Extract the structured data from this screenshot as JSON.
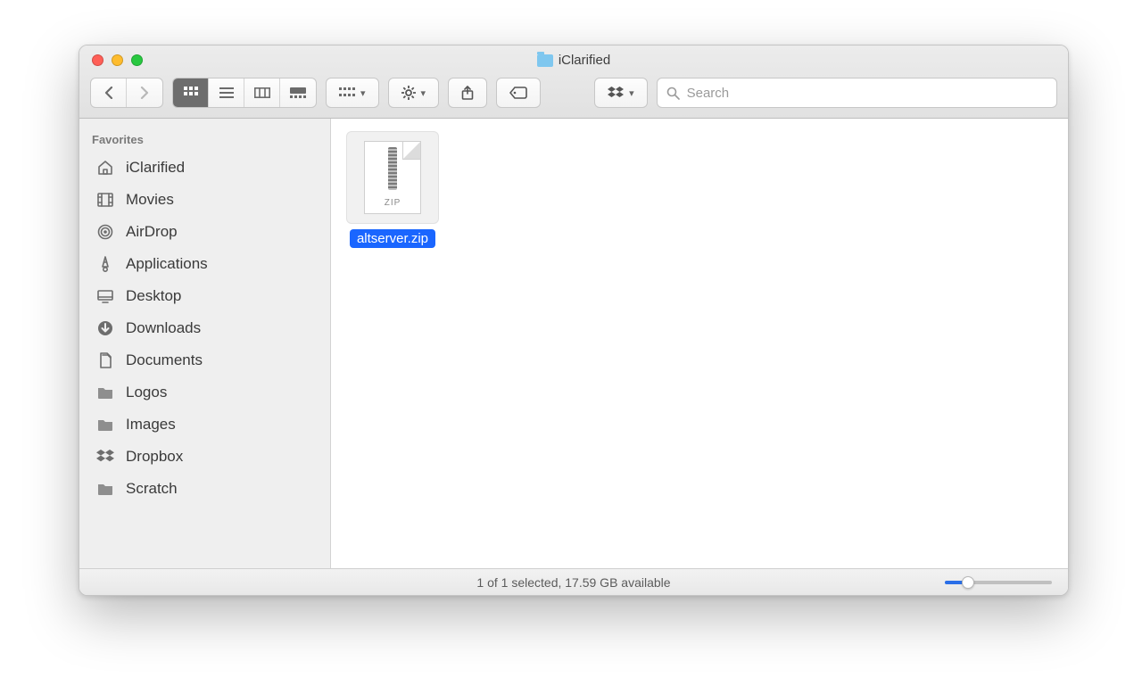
{
  "window": {
    "title": "iClarified"
  },
  "search": {
    "placeholder": "Search",
    "value": ""
  },
  "sidebar": {
    "section_label": "Favorites",
    "items": [
      {
        "icon": "home",
        "label": "iClarified"
      },
      {
        "icon": "movies",
        "label": "Movies"
      },
      {
        "icon": "airdrop",
        "label": "AirDrop"
      },
      {
        "icon": "apps",
        "label": "Applications"
      },
      {
        "icon": "desktop",
        "label": "Desktop"
      },
      {
        "icon": "downloads",
        "label": "Downloads"
      },
      {
        "icon": "documents",
        "label": "Documents"
      },
      {
        "icon": "folder",
        "label": "Logos"
      },
      {
        "icon": "folder",
        "label": "Images"
      },
      {
        "icon": "dropbox",
        "label": "Dropbox"
      },
      {
        "icon": "folder",
        "label": "Scratch"
      }
    ]
  },
  "files": [
    {
      "name": "altserver.zip",
      "type_label": "ZIP",
      "selected": true
    }
  ],
  "status": {
    "text": "1 of 1 selected, 17.59 GB available"
  }
}
